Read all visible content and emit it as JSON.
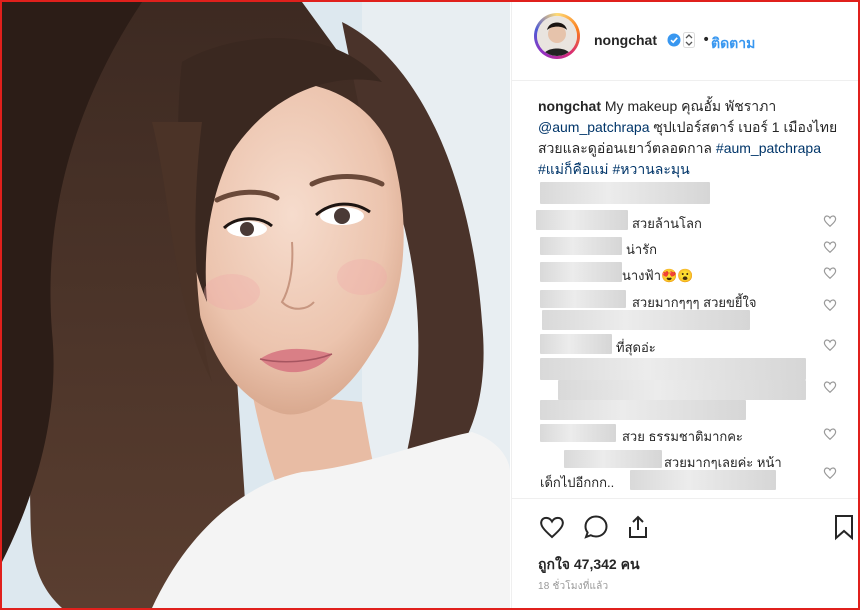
{
  "header": {
    "username": "nongchat",
    "follow_label": "ติดตาม",
    "separator": "•"
  },
  "caption": {
    "username": "nongchat",
    "text_1": " My makeup คุณอั้ม พัชราภา ",
    "mention": "@aum_patchrapa",
    "text_2": " ซุปเปอร์สตาร์ เบอร์ 1 เมืองไทย สวยและดูอ่อนเยาว์ตลอดกาล ",
    "tags": [
      "#aum_patchrapa",
      "#แม่ก็คือแม่",
      "#หวานละมุน"
    ]
  },
  "comments": [
    {
      "text": "สวยล้านโลก"
    },
    {
      "text": "น่ารัก"
    },
    {
      "text": "นางฟ้า😍😮"
    },
    {
      "text": "สวยมากๆๆๆ สวยขยี้ใจ"
    },
    {
      "text": "ที่สุดอ่ะ"
    },
    {
      "text": ""
    },
    {
      "text": "สวย ธรรมชาติมากคะ"
    },
    {
      "text": "สวยมากๆเลยค่ะ หน้า"
    },
    {
      "text": "เด็กไปอีกกก.."
    }
  ],
  "likes": "ถูกใจ 47,342 คน",
  "timestamp": "18 ชั่วโมงที่แล้ว",
  "colors": {
    "link": "#003569",
    "follow": "#3897f0",
    "frame": "#e0201c"
  }
}
